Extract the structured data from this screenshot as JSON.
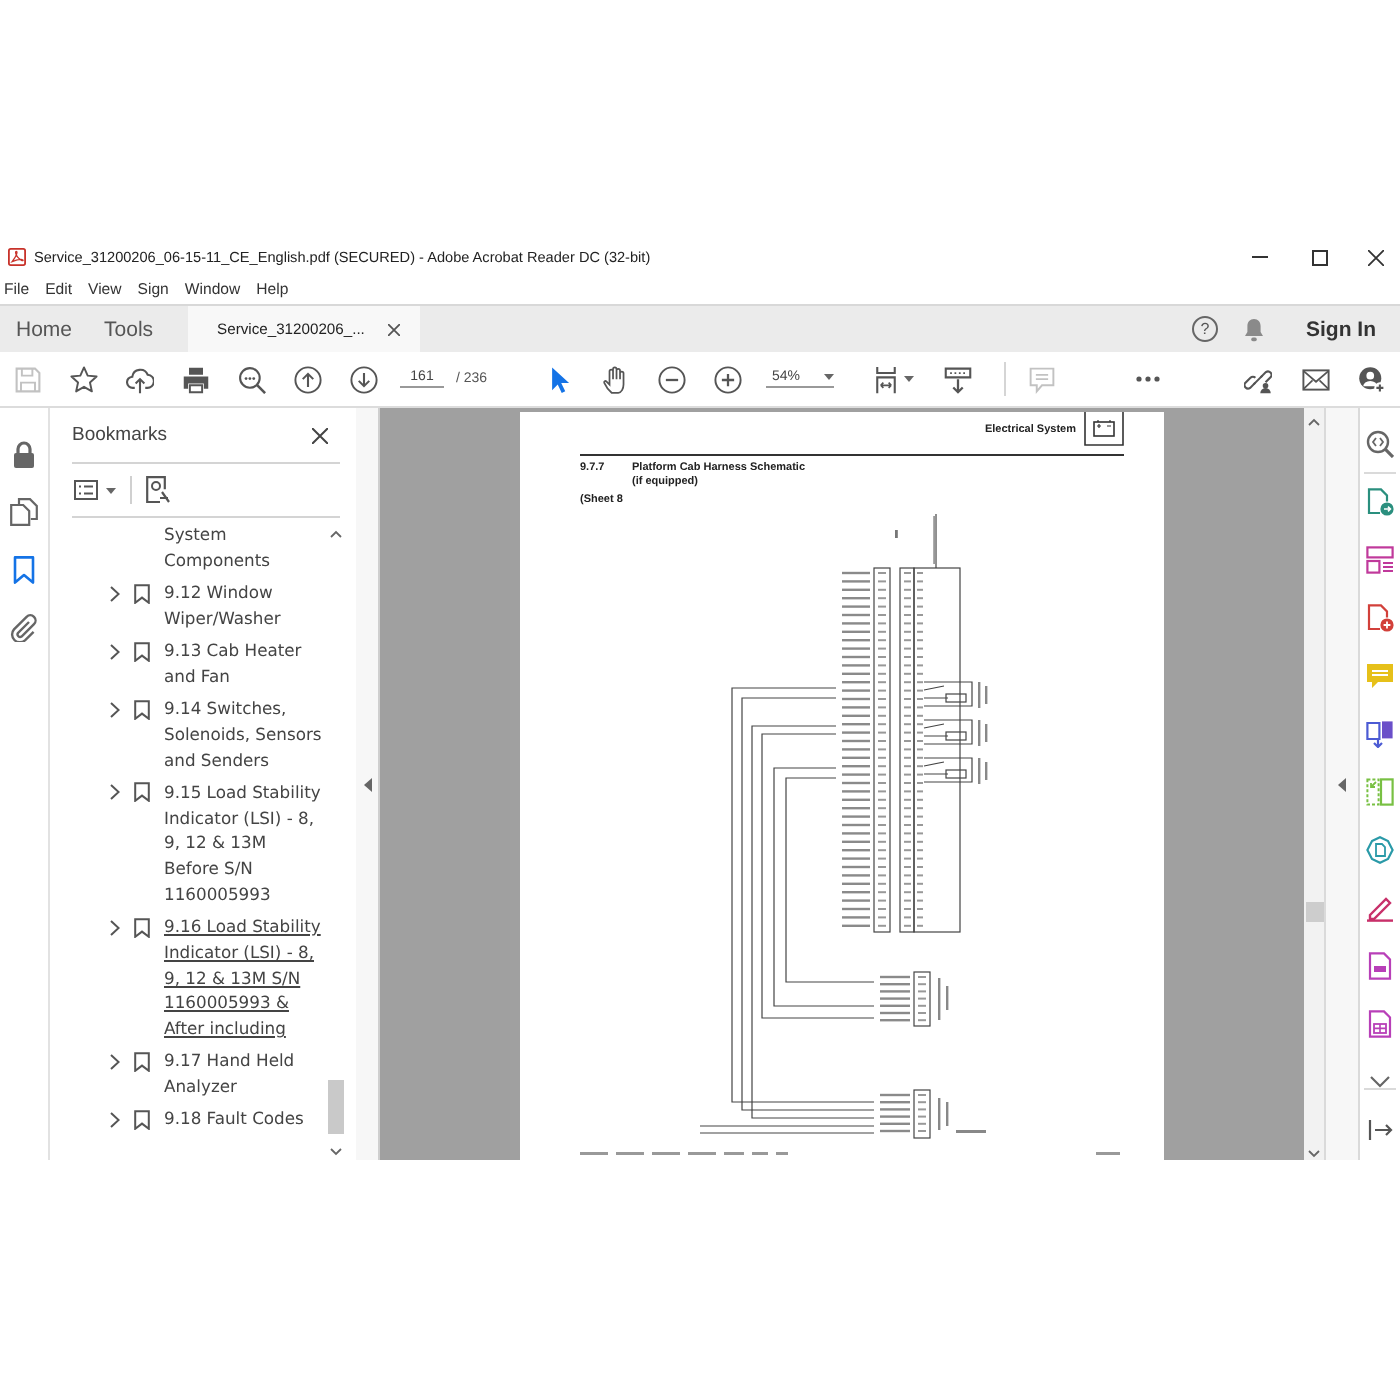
{
  "window": {
    "title": "Service_31200206_06-15-11_CE_English.pdf (SECURED) - Adobe Acrobat Reader DC (32-bit)"
  },
  "menu": [
    "File",
    "Edit",
    "View",
    "Sign",
    "Window",
    "Help"
  ],
  "tabs": [
    {
      "label": "Home",
      "kind": "nav",
      "selected": false,
      "closable": false
    },
    {
      "label": "Tools",
      "kind": "nav",
      "selected": false,
      "closable": false
    },
    {
      "label": "Service_31200206_...",
      "kind": "document",
      "selected": true,
      "closable": true
    }
  ],
  "header_right": {
    "help": "?",
    "sign_in": "Sign In"
  },
  "toolbar": {
    "file_buttons": [
      {
        "kind": "save",
        "disabled": true
      },
      {
        "kind": "star",
        "disabled": false
      },
      {
        "kind": "upload",
        "disabled": false
      },
      {
        "kind": "print",
        "disabled": false
      },
      {
        "kind": "find",
        "disabled": false
      },
      {
        "kind": "previous",
        "disabled": false
      },
      {
        "kind": "next",
        "disabled": false
      }
    ],
    "page_number": "161",
    "page_count": "/ 236",
    "pointer_tools": [
      {
        "kind": "select",
        "selected": true
      },
      {
        "kind": "hand",
        "selected": false
      }
    ],
    "zoom": "54%",
    "comment": {
      "disabled": true
    }
  },
  "left_rail": [
    {
      "kind": "lock",
      "selected": false
    },
    {
      "kind": "pages",
      "selected": false
    },
    {
      "kind": "bookmarks",
      "selected": true
    },
    {
      "kind": "attachments",
      "selected": false
    }
  ],
  "bookmarks": {
    "title": "Bookmarks",
    "clipped_item": "System Components",
    "items": [
      {
        "label": "9.12 Window Wiper/Washer",
        "expanded": false,
        "hovered": false
      },
      {
        "label": "9.13 Cab Heater and Fan",
        "expanded": false,
        "hovered": false
      },
      {
        "label": "9.14 Switches, Solenoids, Sensors and Senders",
        "expanded": false,
        "hovered": false
      },
      {
        "label": "9.15 Load Stability Indicator (LSI) - 8, 9, 12 & 13M Before S/N 1160005993",
        "expanded": false,
        "hovered": false
      },
      {
        "label": "9.16 Load Stability Indicator (LSI) - 8, 9, 12 & 13M S/N 1160005993 & After including",
        "expanded": false,
        "hovered": true
      },
      {
        "label": "9.17 Hand Held Analyzer",
        "expanded": false,
        "hovered": false
      },
      {
        "label": "9.18 Fault Codes",
        "expanded": false,
        "hovered": false
      }
    ]
  },
  "document": {
    "header": "Electrical System",
    "section_number": "9.7.7",
    "section_title": "Platform Cab Harness Schematic",
    "subtitle": "(if equipped)",
    "sheet": "(Sheet 8"
  }
}
